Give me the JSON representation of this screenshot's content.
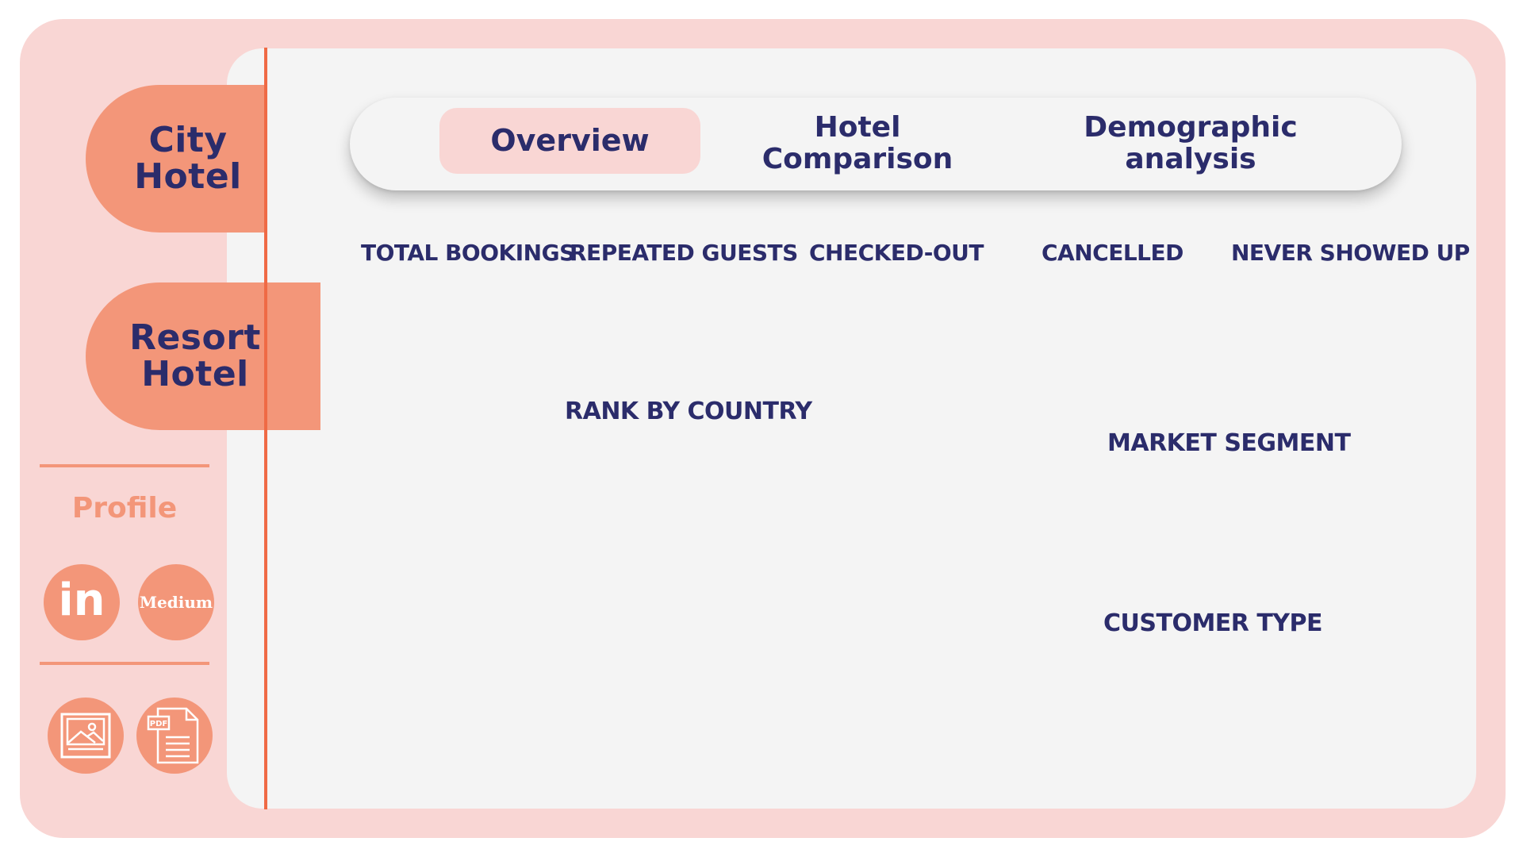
{
  "sidebar": {
    "tabs": [
      {
        "label": "City\nHotel"
      },
      {
        "label": "Resort\nHotel"
      }
    ],
    "profile_label": "Profile",
    "social": [
      {
        "icon": "linkedin-icon",
        "text": "in"
      },
      {
        "icon": "medium-icon",
        "text": "Medium"
      }
    ],
    "downloads": [
      {
        "icon": "image-icon"
      },
      {
        "icon": "pdf-icon",
        "badge": "PDF"
      }
    ]
  },
  "navbar": {
    "items": [
      {
        "label": "Overview",
        "active": true
      },
      {
        "label": "Hotel\nComparison",
        "active": false
      },
      {
        "label": "Demographic\nanalysis",
        "active": false
      }
    ]
  },
  "kpis": [
    "TOTAL BOOKINGS",
    "REPEATED GUESTS",
    "CHECKED-OUT",
    "CANCELLED",
    "NEVER SHOWED UP"
  ],
  "sections": {
    "rank_by_country": "RANK BY COUNTRY",
    "market_segment": "MARKET SEGMENT",
    "customer_type": "CUSTOMER TYPE"
  },
  "colors": {
    "background": "#f9d6d4",
    "panel": "#f4f4f4",
    "accent": "#f39679",
    "accent_line": "#ef6a45",
    "text": "#2b2c6b"
  }
}
